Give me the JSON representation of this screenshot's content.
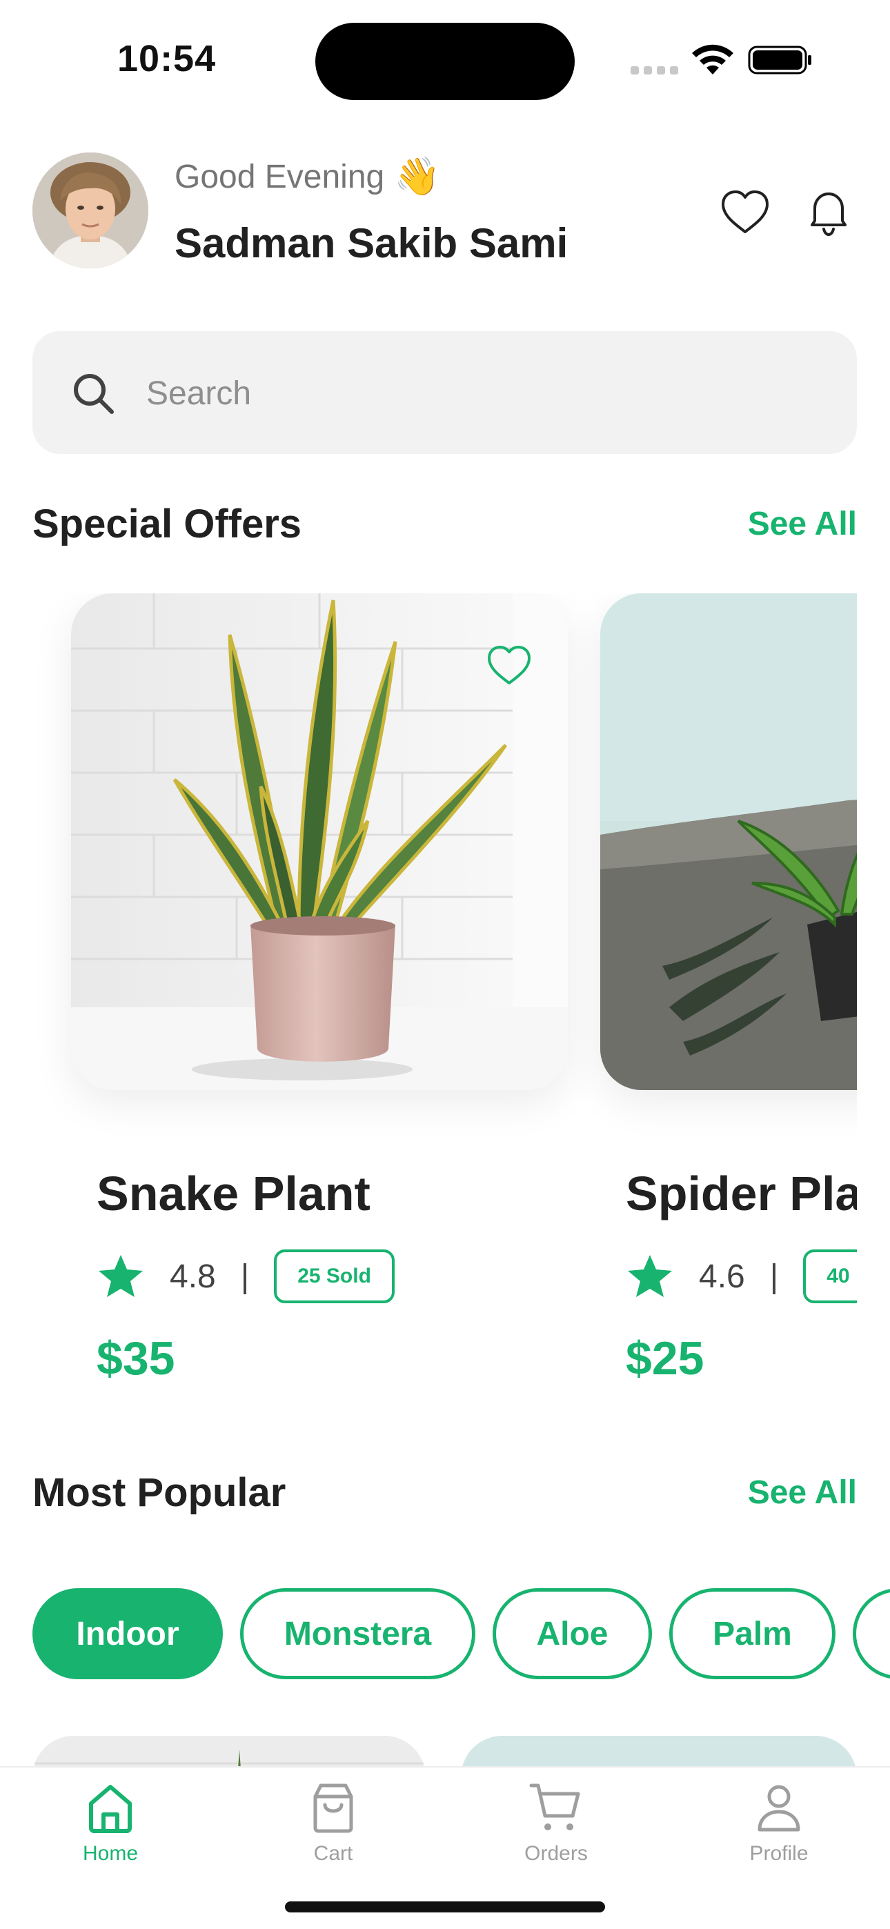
{
  "status_bar": {
    "time": "10:54"
  },
  "header": {
    "greeting": "Good Evening",
    "greeting_emoji": "👋",
    "user_name": "Sadman Sakib Sami"
  },
  "search": {
    "placeholder": "Search",
    "value": ""
  },
  "special_offers": {
    "title": "Special Offers",
    "see_all": "See All",
    "items": [
      {
        "name": "Snake Plant",
        "rating": "4.8",
        "sold": "25 Sold",
        "price": "$35",
        "favorite": false
      },
      {
        "name": "Spider Pla",
        "rating": "4.6",
        "sold": "40",
        "price": "$25",
        "favorite": false
      }
    ]
  },
  "most_popular": {
    "title": "Most Popular",
    "see_all": "See All",
    "categories": [
      {
        "label": "Indoor",
        "active": true
      },
      {
        "label": "Monstera",
        "active": false
      },
      {
        "label": "Aloe",
        "active": false
      },
      {
        "label": "Palm",
        "active": false
      }
    ]
  },
  "tab_bar": {
    "items": [
      {
        "label": "Home",
        "icon": "home-icon",
        "active": true
      },
      {
        "label": "Cart",
        "icon": "bag-icon",
        "active": false
      },
      {
        "label": "Orders",
        "icon": "cart-icon",
        "active": false
      },
      {
        "label": "Profile",
        "icon": "person-icon",
        "active": false
      }
    ]
  },
  "colors": {
    "accent": "#17b36f",
    "text_primary": "#212121",
    "text_secondary": "#757575",
    "search_bg": "#f2f2f2",
    "inactive": "#9e9e9e"
  }
}
